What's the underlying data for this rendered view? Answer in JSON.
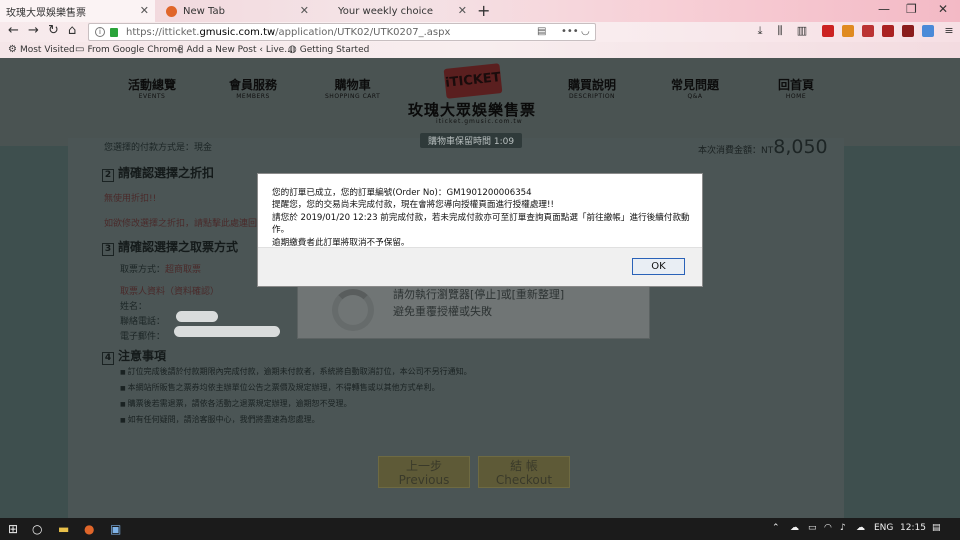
{
  "browser": {
    "tabs": [
      {
        "title": "玫瑰大眾娛樂售票",
        "active": true
      },
      {
        "title": "New Tab",
        "active": false
      },
      {
        "title": "Your weekly choice",
        "active": false
      }
    ],
    "url_prefix": "https://itticket.",
    "url_domain": "gmusic.com.tw",
    "url_path": "/application/UTK02/UTK0207_.aspx",
    "bookmarks": [
      "Most Visited",
      "From Google Chrome",
      "Add a New Post ‹ Live...",
      "Getting Started"
    ],
    "ext_badges": [
      "1",
      "off",
      "1",
      "2"
    ]
  },
  "site": {
    "nav": [
      {
        "zh": "活動總覽",
        "en": "EVENTS"
      },
      {
        "zh": "會員服務",
        "en": "MEMBERS"
      },
      {
        "zh": "購物車",
        "en": "SHOPPING CART"
      },
      {
        "zh": "購買說明",
        "en": "DESCRIPTION"
      },
      {
        "zh": "常見問題",
        "en": "Q&A"
      },
      {
        "zh": "回首頁",
        "en": "HOME"
      }
    ],
    "logo_badge": "iTICKET",
    "logo_title": "玫瑰大眾娛樂售票",
    "logo_sub": "iticket.gmusic.com.tw",
    "cart_timer": "購物車保留時間 1:09"
  },
  "page": {
    "payment_note": "您選擇的付款方式是：現金",
    "total_label": "本次消費金額：NT",
    "total_amount": "8,050",
    "section2_title": "請確認選擇之折扣",
    "section2_text": "無使用折扣!!",
    "section2_hint": "如欲修改選擇之折扣，請點擊此處連回前面進行修改",
    "section3_title": "請確認選擇之取票方式",
    "pickup_label": "取票方式：",
    "pickup_value": "超商取票",
    "recipient_hint": "取票人資料（資料確認）",
    "name_label": "姓名：",
    "phone_label": "聯絡電話：",
    "email_label": "電子郵件：",
    "panel_line1": "請勿執行瀏覽器[停止]或[重新整理]",
    "panel_line2": "避免重覆授權或失敗",
    "section4_title": "注意事項",
    "notes": [
      "訂位完成後請於付款期限內完成付款，逾期未付款者，系統將自動取消訂位，本公司不另行通知。",
      "本網站所販售之票券均依主辦單位公告之票價及規定辦理，不得轉售或以其他方式牟利。",
      "購票後若需退票，請依各活動之退票規定辦理，逾期恕不受理。",
      "如有任何疑問，請洽客服中心，我們將盡速為您處理。"
    ],
    "btn_prev": [
      "上一步",
      "Previous"
    ],
    "btn_next": [
      "結 帳",
      "Checkout"
    ]
  },
  "modal": {
    "line1": "您的訂單已成立，您的訂單編號(Order No)：GM1901200006354",
    "line2": "提醒您，您的交易尚未完成付款，現在會將您導向授權頁面進行授權處理!!",
    "line3": "請您於 2019/01/20 12:23 前完成付款，若未完成付款亦可至訂單查詢頁面點選「前往繳帳」進行後續付款動作。",
    "line4": "逾期繳費者此訂單將取消不予保留。",
    "ok_label": "OK"
  },
  "taskbar": {
    "lang": "ENG",
    "time": "12:15"
  }
}
